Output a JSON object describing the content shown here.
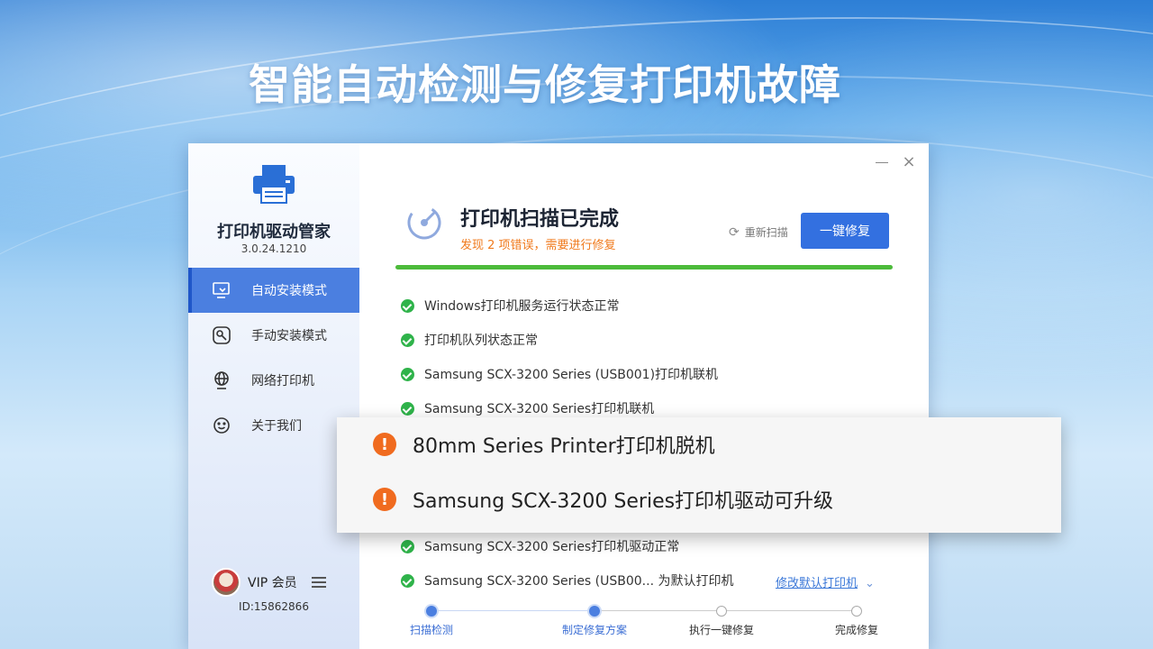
{
  "headline": "智能自动检测与修复打印机故障",
  "app": {
    "name": "打印机驱动管家",
    "version": "3.0.24.1210"
  },
  "nav": [
    {
      "label": "自动安装模式",
      "icon": "monitor-wrench-icon"
    },
    {
      "label": "手动安装模式",
      "icon": "wrench-icon"
    },
    {
      "label": "网络打印机",
      "icon": "globe-icon"
    },
    {
      "label": "关于我们",
      "icon": "smiley-icon"
    }
  ],
  "user": {
    "vip_label": "VIP 会员",
    "id_label": "ID:15862866"
  },
  "scan": {
    "title": "打印机扫描已完成",
    "subtitle": "发现 2 项错误，需要进行修复",
    "rescan_label": "重新扫描",
    "fix_label": "一键修复",
    "progress": 1.0
  },
  "results": [
    {
      "text": "Windows打印机服务运行状态正常",
      "status": "ok"
    },
    {
      "text": "打印机队列状态正常",
      "status": "ok"
    },
    {
      "text": "Samsung SCX-3200 Series (USB001)打印机联机",
      "status": "ok"
    },
    {
      "text": "Samsung SCX-3200 Series打印机联机",
      "status": "ok"
    },
    {
      "text": "Samsung SCX-3200 Series打印机驱动正常",
      "status": "ok"
    },
    {
      "text": "Samsung SCX-3200 Series (USB00... 为默认打印机",
      "status": "ok"
    }
  ],
  "default_printer_link": "修改默认打印机",
  "errors": [
    {
      "text": "80mm Series Printer打印机脱机",
      "status": "warning"
    },
    {
      "text": "Samsung SCX-3200 Series打印机驱动可升级",
      "status": "warning"
    }
  ],
  "steps": [
    {
      "label": "扫描检测",
      "state": "done"
    },
    {
      "label": "制定修复方案",
      "state": "done"
    },
    {
      "label": "执行一键修复",
      "state": "todo"
    },
    {
      "label": "完成修复",
      "state": "todo"
    }
  ],
  "colors": {
    "accent": "#3370e0",
    "ok": "#2fb34a",
    "warning": "#f06b1f",
    "subtitle": "#f07a1d"
  }
}
